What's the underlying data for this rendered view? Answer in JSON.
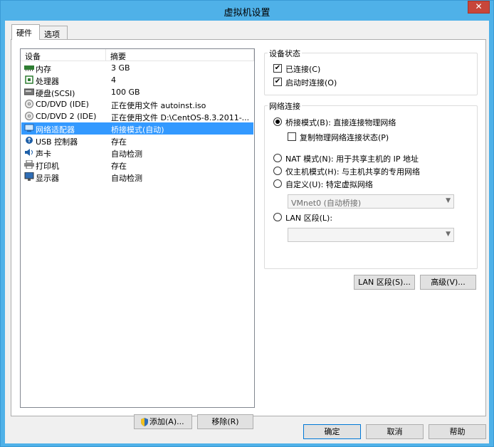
{
  "window": {
    "title": "虚拟机设置",
    "close_glyph": "✕"
  },
  "tabs": [
    {
      "label": "硬件",
      "active": true
    },
    {
      "label": "选项",
      "active": false
    }
  ],
  "device_list": {
    "headers": {
      "device": "设备",
      "summary": "摘要"
    },
    "rows": [
      {
        "name": "内存",
        "summary": "3 GB",
        "icon": "memory-icon"
      },
      {
        "name": "处理器",
        "summary": "4",
        "icon": "processor-icon"
      },
      {
        "name": "硬盘(SCSI)",
        "summary": "100 GB",
        "icon": "harddisk-icon"
      },
      {
        "name": "CD/DVD (IDE)",
        "summary": "正在使用文件 autoinst.iso",
        "icon": "cd-dvd-icon"
      },
      {
        "name": "CD/DVD 2 (IDE)",
        "summary": "正在使用文件 D:\\CentOS-8.3.2011-...",
        "icon": "cd-dvd-icon"
      },
      {
        "name": "网络适配器",
        "summary": "桥接模式(自动)",
        "icon": "network-adapter-icon",
        "selected": true
      },
      {
        "name": "USB 控制器",
        "summary": "存在",
        "icon": "usb-icon"
      },
      {
        "name": "声卡",
        "summary": "自动检测",
        "icon": "sound-card-icon"
      },
      {
        "name": "打印机",
        "summary": "存在",
        "icon": "printer-icon"
      },
      {
        "name": "显示器",
        "summary": "自动检测",
        "icon": "display-icon"
      }
    ],
    "add_button": "添加(A)...",
    "remove_button": "移除(R)"
  },
  "device_status": {
    "title": "设备状态",
    "connected": {
      "label": "已连接(C)",
      "checked": true
    },
    "connect_at_power_on": {
      "label": "启动时连接(O)",
      "checked": true
    }
  },
  "network_connection": {
    "title": "网络连接",
    "bridged": {
      "label": "桥接模式(B): 直接连接物理网络",
      "checked": true
    },
    "replicate": {
      "label": "复制物理网络连接状态(P)",
      "checked": false
    },
    "nat": {
      "label": "NAT 模式(N): 用于共享主机的 IP 地址",
      "checked": false
    },
    "host_only": {
      "label": "仅主机模式(H): 与主机共享的专用网络",
      "checked": false
    },
    "custom": {
      "label": "自定义(U): 特定虚拟网络",
      "checked": false
    },
    "custom_select": {
      "value": "VMnet0 (自动桥接)"
    },
    "lan_segment": {
      "label": "LAN 区段(L):",
      "checked": false
    },
    "lan_select": {
      "value": ""
    },
    "lan_segments_button": "LAN 区段(S)...",
    "advanced_button": "高级(V)..."
  },
  "footer": {
    "ok": "确定",
    "cancel": "取消",
    "help": "帮助"
  },
  "colors": {
    "title_bar": "#4fb1e8",
    "selection": "#3399ff",
    "close": "#c7463a"
  }
}
